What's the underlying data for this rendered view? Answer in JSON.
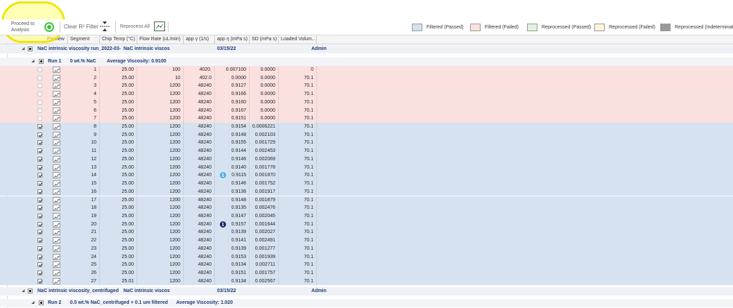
{
  "toolbar": {
    "proceed_label": "Proceed to\nAnalysis",
    "clear_filter_label": "Clear R² Filter",
    "reprocess_label": "Reprocess All"
  },
  "legend": [
    {
      "label": "Filtered (Passed)",
      "color": "#d6e2ef"
    },
    {
      "label": "Filtered (Failed)",
      "color": "#fbe0e0"
    },
    {
      "label": "Reprocessed (Passed)",
      "color": "#e2f3dc"
    },
    {
      "label": "Reprocessed (Failed)",
      "color": "#fbf6d9"
    },
    {
      "label": "Reprocessed (Indeterminate)",
      "color": "#9a9898"
    }
  ],
  "columns": [
    "Preview",
    "Segment",
    "Chip Temp (°C)",
    "Flow Rate (uL/min)",
    "app γ (1/s)",
    "app η (mPa s)",
    "SD (mPa s)",
    "Loaded Volum..."
  ],
  "groups": {
    "g1": {
      "name": "NaC intrinsic viscosity run_2022-03-",
      "desc": "NaC intrinsic viscos",
      "date": "03/15/22",
      "user": "Admin"
    },
    "run1": {
      "name": "Run 1",
      "desc": "0 wt.% NaC",
      "avg": "Average Viscosity: 0.9100"
    },
    "g2": {
      "name": "NaC intrinsic viscosity_centrifuged",
      "desc": "NaC intrinsic viscos",
      "date": "03/15/22",
      "user": "Admin"
    },
    "run2": {
      "name": "Run 2",
      "desc": "0.5 wt.% NaC_centrifuged + 0.1 um filtered",
      "avg": "Average Viscosity: 1.020"
    }
  },
  "rows": [
    {
      "seg": "1",
      "temp": "25.00",
      "flow": "100",
      "gamma": "4020.",
      "eta": "0.007100",
      "sd": "0.0000",
      "vol": "0",
      "status": "failed"
    },
    {
      "seg": "2",
      "temp": "25.00",
      "flow": "10",
      "gamma": "402.0",
      "eta": "0.0000",
      "sd": "0.0000",
      "vol": "70.1",
      "status": "failed"
    },
    {
      "seg": "3",
      "temp": "25.00",
      "flow": "1200",
      "gamma": "48240",
      "eta": "0.9127",
      "sd": "0.0000",
      "vol": "70.1",
      "status": "failed"
    },
    {
      "seg": "4",
      "temp": "25.00",
      "flow": "1200",
      "gamma": "48240",
      "eta": "0.9166",
      "sd": "0.0000",
      "vol": "70.1",
      "status": "failed"
    },
    {
      "seg": "5",
      "temp": "25.00",
      "flow": "1200",
      "gamma": "48240",
      "eta": "0.9160",
      "sd": "0.0000",
      "vol": "70.1",
      "status": "failed"
    },
    {
      "seg": "6",
      "temp": "25.00",
      "flow": "1200",
      "gamma": "48240",
      "eta": "0.9167",
      "sd": "0.0000",
      "vol": "70.1",
      "status": "failed"
    },
    {
      "seg": "7",
      "temp": "25.00",
      "flow": "1200",
      "gamma": "48240",
      "eta": "0.9151",
      "sd": "0.0000",
      "vol": "70.1",
      "status": "failed"
    },
    {
      "seg": "8",
      "temp": "25.00",
      "flow": "1200",
      "gamma": "48240",
      "eta": "0.9154",
      "sd": "0.0006221",
      "vol": "70.1",
      "status": "passed"
    },
    {
      "seg": "9",
      "temp": "25.00",
      "flow": "1200",
      "gamma": "48240",
      "eta": "0.9148",
      "sd": "0.002103",
      "vol": "70.1",
      "status": "passed"
    },
    {
      "seg": "10",
      "temp": "25.00",
      "flow": "1200",
      "gamma": "48240",
      "eta": "0.9155",
      "sd": "0.001729",
      "vol": "70.1",
      "status": "passed"
    },
    {
      "seg": "11",
      "temp": "25.00",
      "flow": "1200",
      "gamma": "48240",
      "eta": "0.9144",
      "sd": "0.002453",
      "vol": "70.1",
      "status": "passed"
    },
    {
      "seg": "12",
      "temp": "25.00",
      "flow": "1200",
      "gamma": "48240",
      "eta": "0.9146",
      "sd": "0.002069",
      "vol": "70.1",
      "status": "passed"
    },
    {
      "seg": "13",
      "temp": "25.00",
      "flow": "1200",
      "gamma": "48240",
      "eta": "0.9140",
      "sd": "0.001778",
      "vol": "70.1",
      "status": "passed"
    },
    {
      "seg": "14",
      "temp": "25.00",
      "flow": "1200",
      "gamma": "48240",
      "eta": "0.9115",
      "sd": "0.001870",
      "vol": "70.1",
      "status": "passed",
      "info": "light"
    },
    {
      "seg": "15",
      "temp": "25.00",
      "flow": "1200",
      "gamma": "48240",
      "eta": "0.9146",
      "sd": "0.001752",
      "vol": "70.1",
      "status": "passed"
    },
    {
      "seg": "16",
      "temp": "25.00",
      "flow": "1200",
      "gamma": "48240",
      "eta": "0.9136",
      "sd": "0.001917",
      "vol": "70.1",
      "status": "passed"
    },
    {
      "seg": "17",
      "temp": "25.00",
      "flow": "1200",
      "gamma": "48240",
      "eta": "0.9148",
      "sd": "0.001879",
      "vol": "70.1",
      "status": "passed"
    },
    {
      "seg": "18",
      "temp": "25.00",
      "flow": "1200",
      "gamma": "48240",
      "eta": "0.9135",
      "sd": "0.002476",
      "vol": "70.1",
      "status": "passed"
    },
    {
      "seg": "19",
      "temp": "25.00",
      "flow": "1200",
      "gamma": "48240",
      "eta": "0.9147",
      "sd": "0.002045",
      "vol": "70.1",
      "status": "passed"
    },
    {
      "seg": "20",
      "temp": "25.00",
      "flow": "1200",
      "gamma": "48240",
      "eta": "0.9157",
      "sd": "0.001644",
      "vol": "70.1",
      "status": "passed",
      "info": "dark"
    },
    {
      "seg": "21",
      "temp": "25.00",
      "flow": "1200",
      "gamma": "48240",
      "eta": "0.9139",
      "sd": "0.002027",
      "vol": "70.1",
      "status": "passed"
    },
    {
      "seg": "22",
      "temp": "25.00",
      "flow": "1200",
      "gamma": "48240",
      "eta": "0.9141",
      "sd": "0.002491",
      "vol": "70.1",
      "status": "passed"
    },
    {
      "seg": "23",
      "temp": "25.00",
      "flow": "1200",
      "gamma": "48240",
      "eta": "0.9139",
      "sd": "0.001277",
      "vol": "70.1",
      "status": "passed"
    },
    {
      "seg": "24",
      "temp": "25.00",
      "flow": "1200",
      "gamma": "48240",
      "eta": "0.9153",
      "sd": "0.001939",
      "vol": "70.1",
      "status": "passed"
    },
    {
      "seg": "25",
      "temp": "25.00",
      "flow": "1200",
      "gamma": "48240",
      "eta": "0.9134",
      "sd": "0.002711",
      "vol": "70.1",
      "status": "passed"
    },
    {
      "seg": "26",
      "temp": "25.00",
      "flow": "1200",
      "gamma": "48240",
      "eta": "0.9151",
      "sd": "0.001757",
      "vol": "70.1",
      "status": "passed"
    },
    {
      "seg": "27",
      "temp": "25.01",
      "flow": "1200",
      "gamma": "48240",
      "eta": "0.9134",
      "sd": "0.002567",
      "vol": "70.1",
      "status": "passed"
    }
  ]
}
